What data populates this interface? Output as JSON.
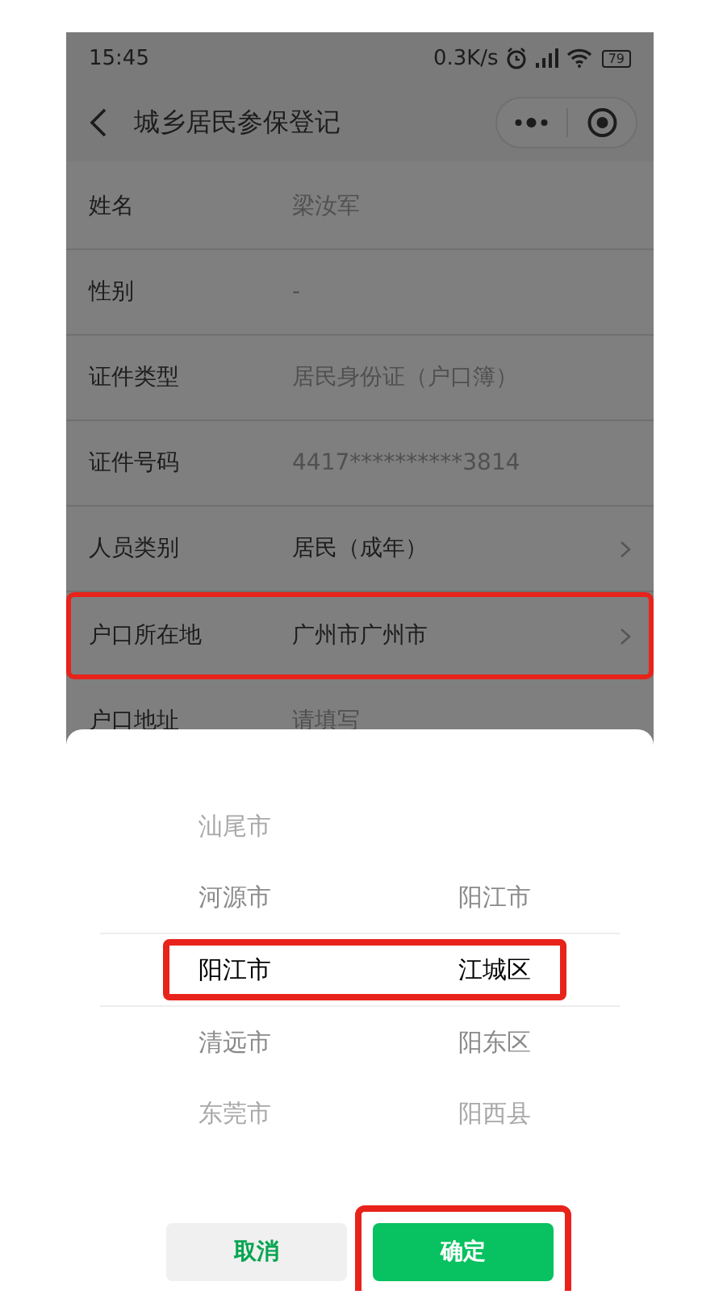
{
  "status_bar": {
    "time": "15:45",
    "speed": "0.3K/s",
    "battery": "79"
  },
  "nav": {
    "title": "城乡居民参保登记"
  },
  "form_rows": [
    {
      "label": "姓名",
      "value": "梁汝军",
      "editable": false,
      "highlighted": false
    },
    {
      "label": "性别",
      "value": "-",
      "editable": false,
      "highlighted": false
    },
    {
      "label": "证件类型",
      "value": "居民身份证（户口簿）",
      "editable": false,
      "highlighted": false
    },
    {
      "label": "证件号码",
      "value": "4417**********3814",
      "editable": false,
      "highlighted": false
    },
    {
      "label": "人员类别",
      "value": "居民（成年）",
      "editable": true,
      "highlighted": false
    },
    {
      "label": "户口所在地",
      "value": "广州市广州市",
      "editable": true,
      "highlighted": true
    },
    {
      "label": "户口地址",
      "placeholder": "请填写",
      "editable": false,
      "highlighted": false
    }
  ],
  "picker": {
    "rows": [
      {
        "city": "汕尾市",
        "selected": false
      },
      {
        "city": "河源市",
        "district": "阳江市",
        "selected": false
      },
      {
        "city": "阳江市",
        "district": "江城区",
        "selected": true,
        "highlighted": true
      },
      {
        "city": "清远市",
        "district": "阳东区",
        "selected": false
      },
      {
        "city": "东莞市",
        "district": "阳西县",
        "selected": false
      }
    ],
    "buttons": [
      {
        "label": "取消",
        "kind": "cancel",
        "highlighted": false
      },
      {
        "label": "确定",
        "kind": "confirm",
        "highlighted": true
      }
    ]
  }
}
